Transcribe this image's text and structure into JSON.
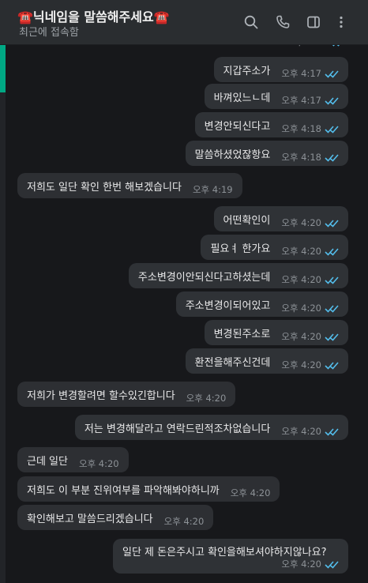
{
  "header": {
    "title": "☎️닉네임을 말씀해주세요☎️",
    "subtitle": "최근에 접속함",
    "icons": [
      "search-icon",
      "phone-icon",
      "side-panel-icon",
      "more-vert-icon"
    ]
  },
  "colors": {
    "background": "#17181b",
    "header": "#2a2d30",
    "bubble": "#2d2f33",
    "accent": "#00a884",
    "read_ticks": "#53bdeb"
  },
  "messages": [
    {
      "text": "지갑주소가",
      "time": "오후 4:17",
      "dir": "out"
    },
    {
      "text": "바껴있느ㄴ데",
      "time": "오후 4:17",
      "dir": "out"
    },
    {
      "text": "변경안되신다고",
      "time": "오후 4:18",
      "dir": "out"
    },
    {
      "text": "말씀하셨었잖항요",
      "time": "오후 4:18",
      "dir": "out"
    },
    {
      "text": "저희도 일단 확인 한번 해보겠습니다",
      "time": "오후 4:19",
      "dir": "in"
    },
    {
      "text": "어떤확인이",
      "time": "오후 4:20",
      "dir": "out"
    },
    {
      "text": "필요ㅕ 한가요",
      "time": "오후 4:20",
      "dir": "out"
    },
    {
      "text": "주소변경이안되신다고하셨는데",
      "time": "오후 4:20",
      "dir": "out"
    },
    {
      "text": "주소변경이되어있고",
      "time": "오후 4:20",
      "dir": "out"
    },
    {
      "text": "변경된주소로",
      "time": "오후 4:20",
      "dir": "out"
    },
    {
      "text": "환전을해주신건데",
      "time": "오후 4:20",
      "dir": "out"
    },
    {
      "text": "저희가 변경할려면 할수있긴합니다",
      "time": "오후 4:20",
      "dir": "in"
    },
    {
      "text": "저는 변경해달라고 연락드린적조차없습니다",
      "time": "오후 4:20",
      "dir": "out"
    },
    {
      "text": "근데 일단",
      "time": "오후 4:20",
      "dir": "in"
    },
    {
      "text": "저희도 이 부분 진위여부를 파악해봐야하니까",
      "time": "오후 4:20",
      "dir": "in"
    },
    {
      "text": "확인해보고 말씀드리겠습니다",
      "time": "오후 4:20",
      "dir": "in"
    },
    {
      "text": "일단 제 돈은주시고 확인을해보셔야하지않나요?",
      "time": "오후 4:20",
      "dir": "out"
    }
  ],
  "partial_top": {
    "time": "오후 4:17"
  }
}
